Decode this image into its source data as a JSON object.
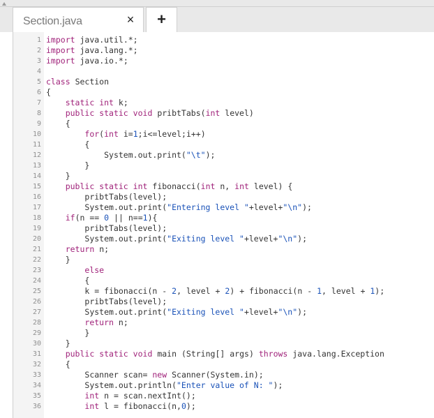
{
  "window": {
    "tab_title": "Section.java",
    "close_glyph": "×",
    "new_tab_glyph": "+"
  },
  "colors": {
    "keyword": "#a0227a",
    "literal": "#1a52b8",
    "plain": "#333333",
    "line_number": "#8f8f8f",
    "gutter": "#f4f4f4",
    "topbar": "#e9e9e9"
  },
  "editor": {
    "lines": [
      "import java.util.*;",
      "import java.lang.*;",
      "import java.io.*;",
      "",
      "class Section",
      "{",
      "    static int k;",
      "    public static void pribtTabs(int level)",
      "    {",
      "        for(int i=1;i<=level;i++)",
      "        {",
      "            System.out.print(\"\\t\");",
      "        }",
      "    }",
      "    public static int fibonacci(int n, int level) {",
      "        pribtTabs(level);",
      "        System.out.print(\"Entering level \"+level+\"\\n\");",
      "    if(n == 0 || n==1){",
      "        pribtTabs(level);",
      "        System.out.print(\"Exiting level \"+level+\"\\n\");",
      "    return n;",
      "    }",
      "        else",
      "        {",
      "        k = fibonacci(n - 2, level + 2) + fibonacci(n - 1, level + 1);",
      "        pribtTabs(level);",
      "        System.out.print(\"Exiting level \"+level+\"\\n\");",
      "        return n;",
      "        }",
      "    }",
      "    public static void main (String[] args) throws java.lang.Exception",
      "    {",
      "        Scanner scan= new Scanner(System.in);",
      "        System.out.println(\"Enter value of N: \");",
      "        int n = scan.nextInt();",
      "        int l = fibonacci(n,0);"
    ]
  }
}
